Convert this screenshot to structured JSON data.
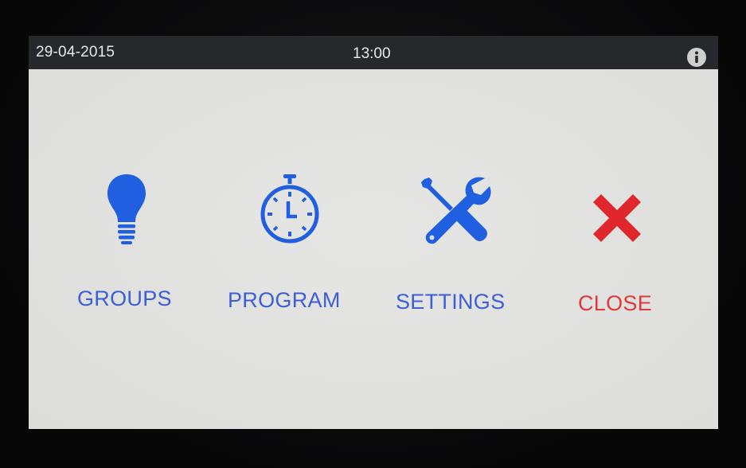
{
  "status_bar": {
    "date": "29-04-2015",
    "time": "13:00",
    "info_icon": "info-icon"
  },
  "menu": {
    "groups_label": "GROUPS",
    "groups_icon": "lightbulb-icon",
    "program_label": "PROGRAM",
    "program_icon": "stopwatch-icon",
    "settings_label": "SETTINGS",
    "settings_icon": "wrench-screwdriver-icon",
    "close_label": "CLOSE",
    "close_icon": "close-x-icon"
  },
  "colors": {
    "accent_blue": "#3a5fd6",
    "icon_blue": "#1f5fe0",
    "close_red": "#e0383c",
    "status_bar": "#26282b",
    "screen_bg": "#e1e1df"
  }
}
